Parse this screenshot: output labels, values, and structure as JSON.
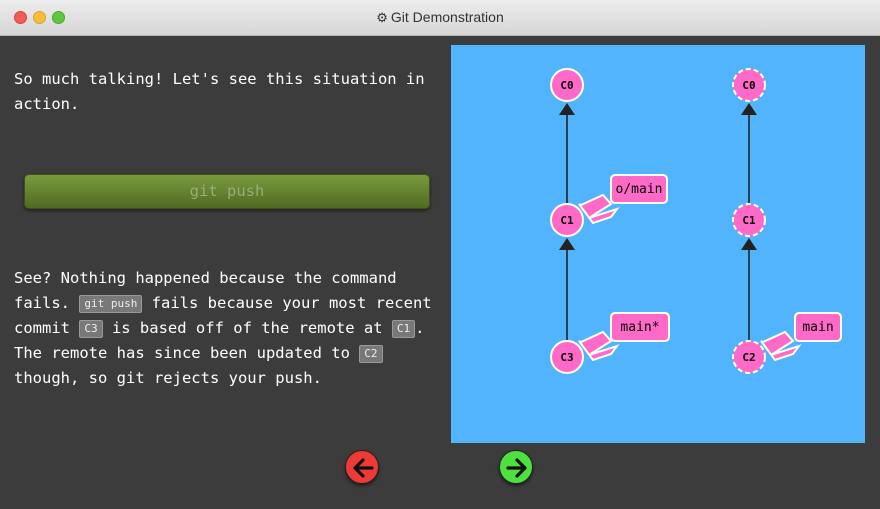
{
  "window": {
    "title": "Git Demonstration",
    "title_icon": "gear-icon"
  },
  "lesson": {
    "intro": "So much talking! Let's see this situation in action.",
    "command_button": "git push",
    "explanation": {
      "p1": "See? Nothing happened because the command fails.",
      "code1": "git push",
      "p2": "fails because your most recent commit",
      "code2": "C3",
      "p3": "is based off of the remote at",
      "code3": "C1",
      "p4": ". The remote has since been updated to",
      "code4": "C2",
      "p5": "though, so git rejects your push."
    }
  },
  "graph": {
    "colors": {
      "canvas": "#52b4fc",
      "commit": "#ff69c8",
      "branch_label": "#ff69c8",
      "edge": "#222222"
    },
    "local": {
      "commits": [
        "C0",
        "C1",
        "C3"
      ],
      "branches": [
        {
          "name": "o/main",
          "target": "C1"
        },
        {
          "name": "main*",
          "target": "C3"
        }
      ]
    },
    "remote": {
      "commits": [
        "C0",
        "C1",
        "C2"
      ],
      "branches": [
        {
          "name": "main",
          "target": "C2"
        }
      ]
    }
  },
  "navigation": {
    "back_icon": "arrow-left-icon",
    "next_icon": "arrow-right-icon",
    "back_color": "#ee3a35",
    "next_color": "#4ee03f"
  }
}
